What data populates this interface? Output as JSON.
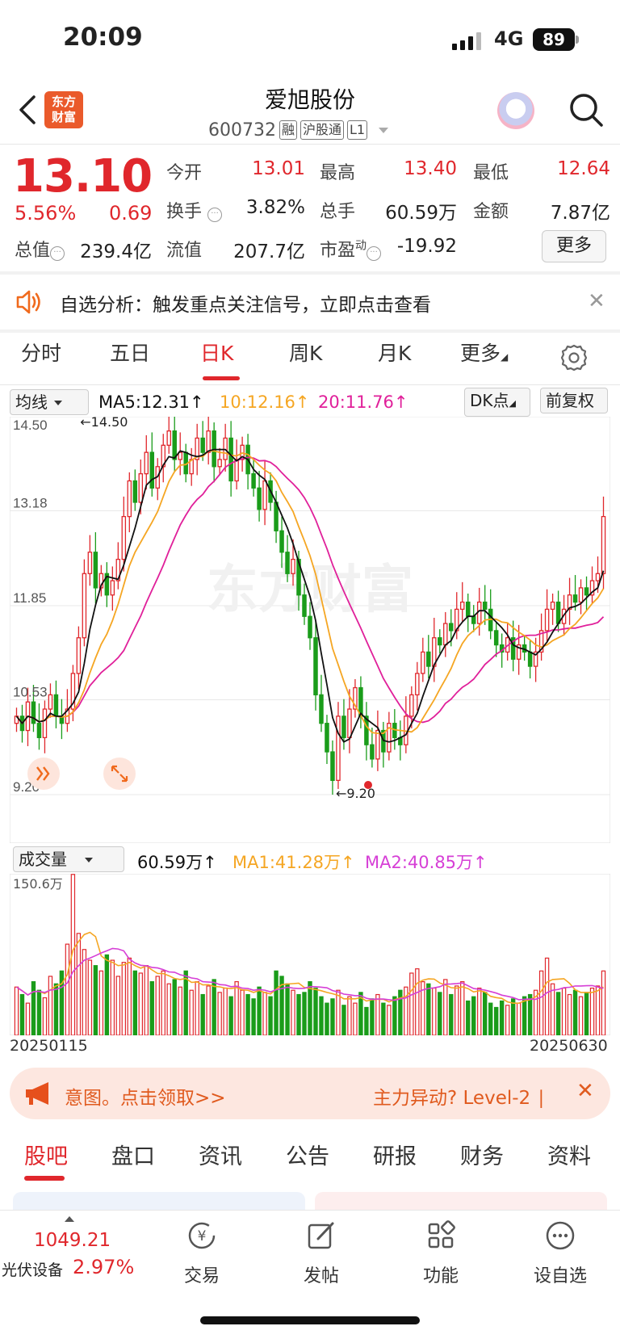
{
  "status_bar": {
    "time": "20:09",
    "network": "4G",
    "battery": "89"
  },
  "header": {
    "logo_text": "东方财富",
    "stock_name": "爱旭股份",
    "stock_code": "600732",
    "tags": [
      "融",
      "沪股通",
      "L1"
    ]
  },
  "quote": {
    "price": "13.10",
    "change_pct": "5.56%",
    "change": "0.69",
    "fields": [
      {
        "label": "今开",
        "value": "13.01"
      },
      {
        "label": "最高",
        "value": "13.40"
      },
      {
        "label": "最低",
        "value": "12.64"
      },
      {
        "label": "换手",
        "value": "3.82%"
      },
      {
        "label": "总手",
        "value": "60.59万"
      },
      {
        "label": "金额",
        "value": "7.87亿"
      },
      {
        "label": "总值",
        "value": "239.4亿"
      },
      {
        "label": "流值",
        "value": "207.7亿"
      },
      {
        "label": "市盈",
        "value": "-19.92"
      }
    ],
    "pe_superscript": "动",
    "more_label": "更多"
  },
  "alert": {
    "text": "自选分析：触发重点关注信号，立即点击查看"
  },
  "chart_tabs": {
    "tabs": [
      "分时",
      "五日",
      "日K",
      "周K",
      "月K",
      "更多"
    ],
    "active": "日K"
  },
  "ma_bar": {
    "selector": "均线",
    "ma5": "MA5:12.31↑",
    "ma10": "10:12.16↑",
    "ma20": "20:11.76↑",
    "dk_button": "DK点",
    "adjust_button": "前复权"
  },
  "kline": {
    "y_labels": [
      "14.50",
      "13.18",
      "11.85",
      "10.53",
      "9.20"
    ],
    "high_marker": "←14.50",
    "low_marker": "←9.20",
    "watermark": "东方财富"
  },
  "volume_bar": {
    "selector": "成交量",
    "vol": "60.59万↑",
    "ma1": "MA1:41.28万↑",
    "ma2": "MA2:40.85万↑",
    "max_label": "150.6万"
  },
  "dates": {
    "start": "20250115",
    "end": "20250630"
  },
  "colors": {
    "up": "#e0272c",
    "down": "#1a9c1a",
    "ma5": "#111111",
    "ma10": "#f5a623",
    "ma20": "#e0209a",
    "accent": "#e0272c"
  },
  "promo": {
    "left_text": "意图。点击领取>>",
    "right_text": "主力异动? Level-2 ∣"
  },
  "bottom_tabs": {
    "tabs": [
      "股吧",
      "盘口",
      "资讯",
      "公告",
      "研报",
      "财务",
      "资料"
    ],
    "active": "股吧"
  },
  "bottom_bar": {
    "index_value": "1049.21",
    "index_name": "光伏设备",
    "index_pct": "2.97%",
    "nav": [
      {
        "label": "交易",
        "icon": "trade-icon"
      },
      {
        "label": "发帖",
        "icon": "post-icon"
      },
      {
        "label": "功能",
        "icon": "apps-icon"
      },
      {
        "label": "设自选",
        "icon": "more-icon"
      }
    ]
  },
  "chart_data": [
    {
      "type": "candlestick",
      "title": "",
      "x_range": [
        "20250115",
        "20250630"
      ],
      "ylim": [
        9.2,
        14.5
      ],
      "y_ticks": [
        14.5,
        13.18,
        11.85,
        10.53,
        9.2
      ],
      "series": [
        {
          "name": "MA5",
          "last": 12.31
        },
        {
          "name": "MA10",
          "last": 12.16
        },
        {
          "name": "MA20",
          "last": 11.76
        }
      ],
      "close": [
        10.3,
        10.1,
        10.5,
        10.2,
        10.0,
        10.4,
        10.6,
        10.3,
        10.2,
        10.4,
        10.9,
        11.4,
        12.3,
        12.6,
        12.1,
        12.3,
        12.0,
        12.2,
        12.5,
        13.1,
        13.6,
        13.3,
        13.7,
        14.0,
        13.5,
        13.8,
        14.1,
        14.3,
        13.9,
        14.0,
        13.7,
        13.9,
        14.2,
        14.0,
        14.3,
        13.8,
        13.9,
        14.2,
        13.6,
        13.9,
        14.1,
        13.7,
        13.5,
        13.2,
        13.6,
        13.3,
        12.9,
        12.6,
        12.3,
        12.5,
        12.0,
        11.7,
        11.4,
        10.6,
        10.2,
        9.8,
        9.4,
        10.3,
        10.0,
        10.4,
        10.7,
        10.3,
        9.9,
        9.7,
        10.1,
        9.8,
        10.2,
        10.0,
        9.9,
        10.3,
        10.6,
        10.9,
        11.2,
        11.0,
        11.4,
        11.3,
        11.6,
        11.5,
        11.8,
        11.9,
        11.7,
        11.6,
        11.9,
        11.8,
        11.5,
        11.3,
        11.2,
        11.4,
        11.1,
        11.3,
        11.2,
        11.0,
        11.2,
        11.5,
        11.8,
        11.9,
        11.6,
        11.8,
        12.0,
        11.9,
        12.1,
        12.0,
        12.2,
        12.3,
        13.1
      ],
      "high_point": 14.5,
      "low_point": 9.2
    },
    {
      "type": "bar",
      "title": "",
      "ylim": [
        0,
        150.6
      ],
      "y_unit": "万",
      "series": [
        {
          "name": "MA1",
          "last": 41.28
        },
        {
          "name": "MA2",
          "last": 40.85
        }
      ],
      "values": [
        45,
        38,
        30,
        50,
        42,
        35,
        55,
        48,
        60,
        85,
        150,
        95,
        80,
        70,
        65,
        60,
        75,
        70,
        55,
        68,
        72,
        60,
        58,
        65,
        50,
        55,
        60,
        48,
        52,
        45,
        60,
        42,
        50,
        38,
        46,
        52,
        40,
        44,
        36,
        50,
        42,
        38,
        34,
        45,
        40,
        36,
        60,
        55,
        48,
        42,
        38,
        40,
        50,
        44,
        36,
        30,
        34,
        42,
        28,
        36,
        30,
        40,
        26,
        34,
        38,
        30,
        28,
        36,
        42,
        45,
        58,
        62,
        50,
        48,
        44,
        40,
        52,
        38,
        46,
        50,
        32,
        36,
        44,
        40,
        30,
        26,
        32,
        28,
        34,
        30,
        36,
        38,
        42,
        60,
        72,
        48,
        40,
        44,
        38,
        42,
        36,
        40,
        44,
        46,
        60
      ]
    }
  ]
}
